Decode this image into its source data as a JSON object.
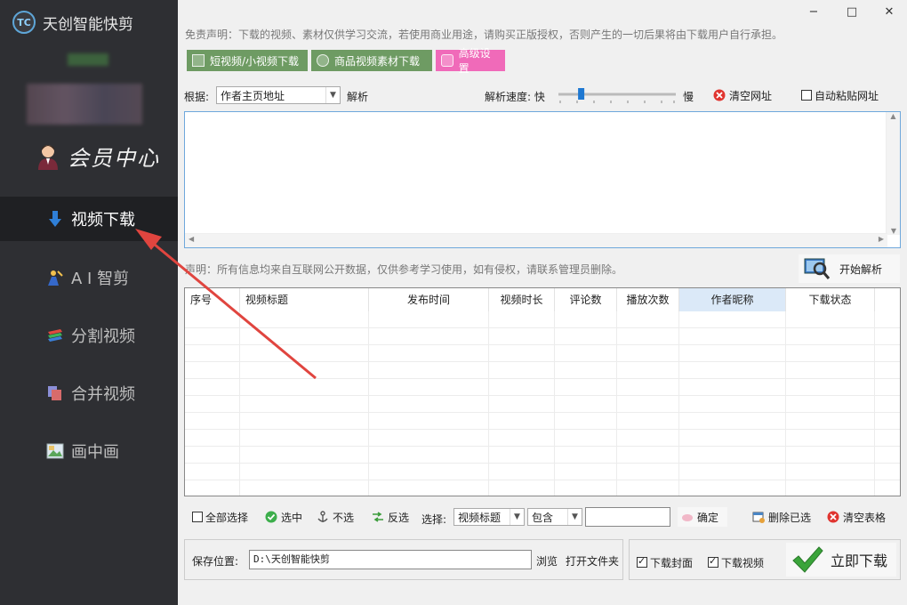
{
  "app": {
    "title": "天创智能快剪",
    "logo_text": "TC"
  },
  "sidebar": {
    "vip_label": "会员中心",
    "items": [
      {
        "label": "视频下载",
        "icon": "down-arrow-icon",
        "active": true
      },
      {
        "label": "A I 智剪",
        "icon": "ai-figure-icon",
        "active": false
      },
      {
        "label": "分割视频",
        "icon": "split-stack-icon",
        "active": false
      },
      {
        "label": "合并视频",
        "icon": "merge-stack-icon",
        "active": false
      },
      {
        "label": "画中画",
        "icon": "picture-in-picture-icon",
        "active": false
      }
    ]
  },
  "window": {
    "minimize": "−",
    "maximize": "□",
    "close": "✕"
  },
  "disclaimer": "免责声明：下载的视频、素材仅供学习交流，若使用商业用途，请购买正版授权，否则产生的一切后果将由下载用户自行承担。",
  "tabs": [
    {
      "label": "短视频/小视频下载",
      "color": "#6e9b63"
    },
    {
      "label": "商品视频素材下载",
      "color": "#6e9b63"
    },
    {
      "label": "高级设置",
      "color": "#f06ab9"
    }
  ],
  "parse_bar": {
    "basis_label": "根据:",
    "basis_value": "作者主页地址",
    "parse_label": "解析",
    "speed_label": "解析速度: 快",
    "slow_label": "慢",
    "speed_level": 0.2,
    "clear_url_label": "清空网址",
    "auto_paste_label": "自动粘贴网址",
    "auto_paste_checked": false
  },
  "url_box": {
    "value": ""
  },
  "notice": "声明：所有信息均来自互联网公开数据，仅供参考学习使用，如有侵权，请联系管理员删除。",
  "start_parse_label": "开始解析",
  "table": {
    "columns": [
      "序号",
      "视频标题",
      "发布时间",
      "视频时长",
      "评论数",
      "播放次数",
      "作者昵称",
      "下载状态"
    ],
    "rows": []
  },
  "actions": {
    "select_all": "全部选择",
    "select": "选中",
    "unselect": "不选",
    "invert": "反选",
    "choose_label": "选择:",
    "field_value": "视频标题",
    "match_value": "包含",
    "filter_value": "",
    "confirm": "确定",
    "delete_selected": "删除已选",
    "clear_table": "清空表格"
  },
  "save": {
    "label": "保存位置:",
    "path": "D:\\天创智能快剪",
    "browse": "浏览",
    "open_folder": "打开文件夹"
  },
  "download": {
    "cover_label": "下载封面",
    "cover_checked": true,
    "video_label": "下载视频",
    "video_checked": true,
    "button_label": "立即下载"
  },
  "colors": {
    "sidebar_bg": "#2e2f33",
    "sidebar_active": "#1f2023",
    "arrow": "#e0453f",
    "accent_blue": "#1e78d2"
  }
}
